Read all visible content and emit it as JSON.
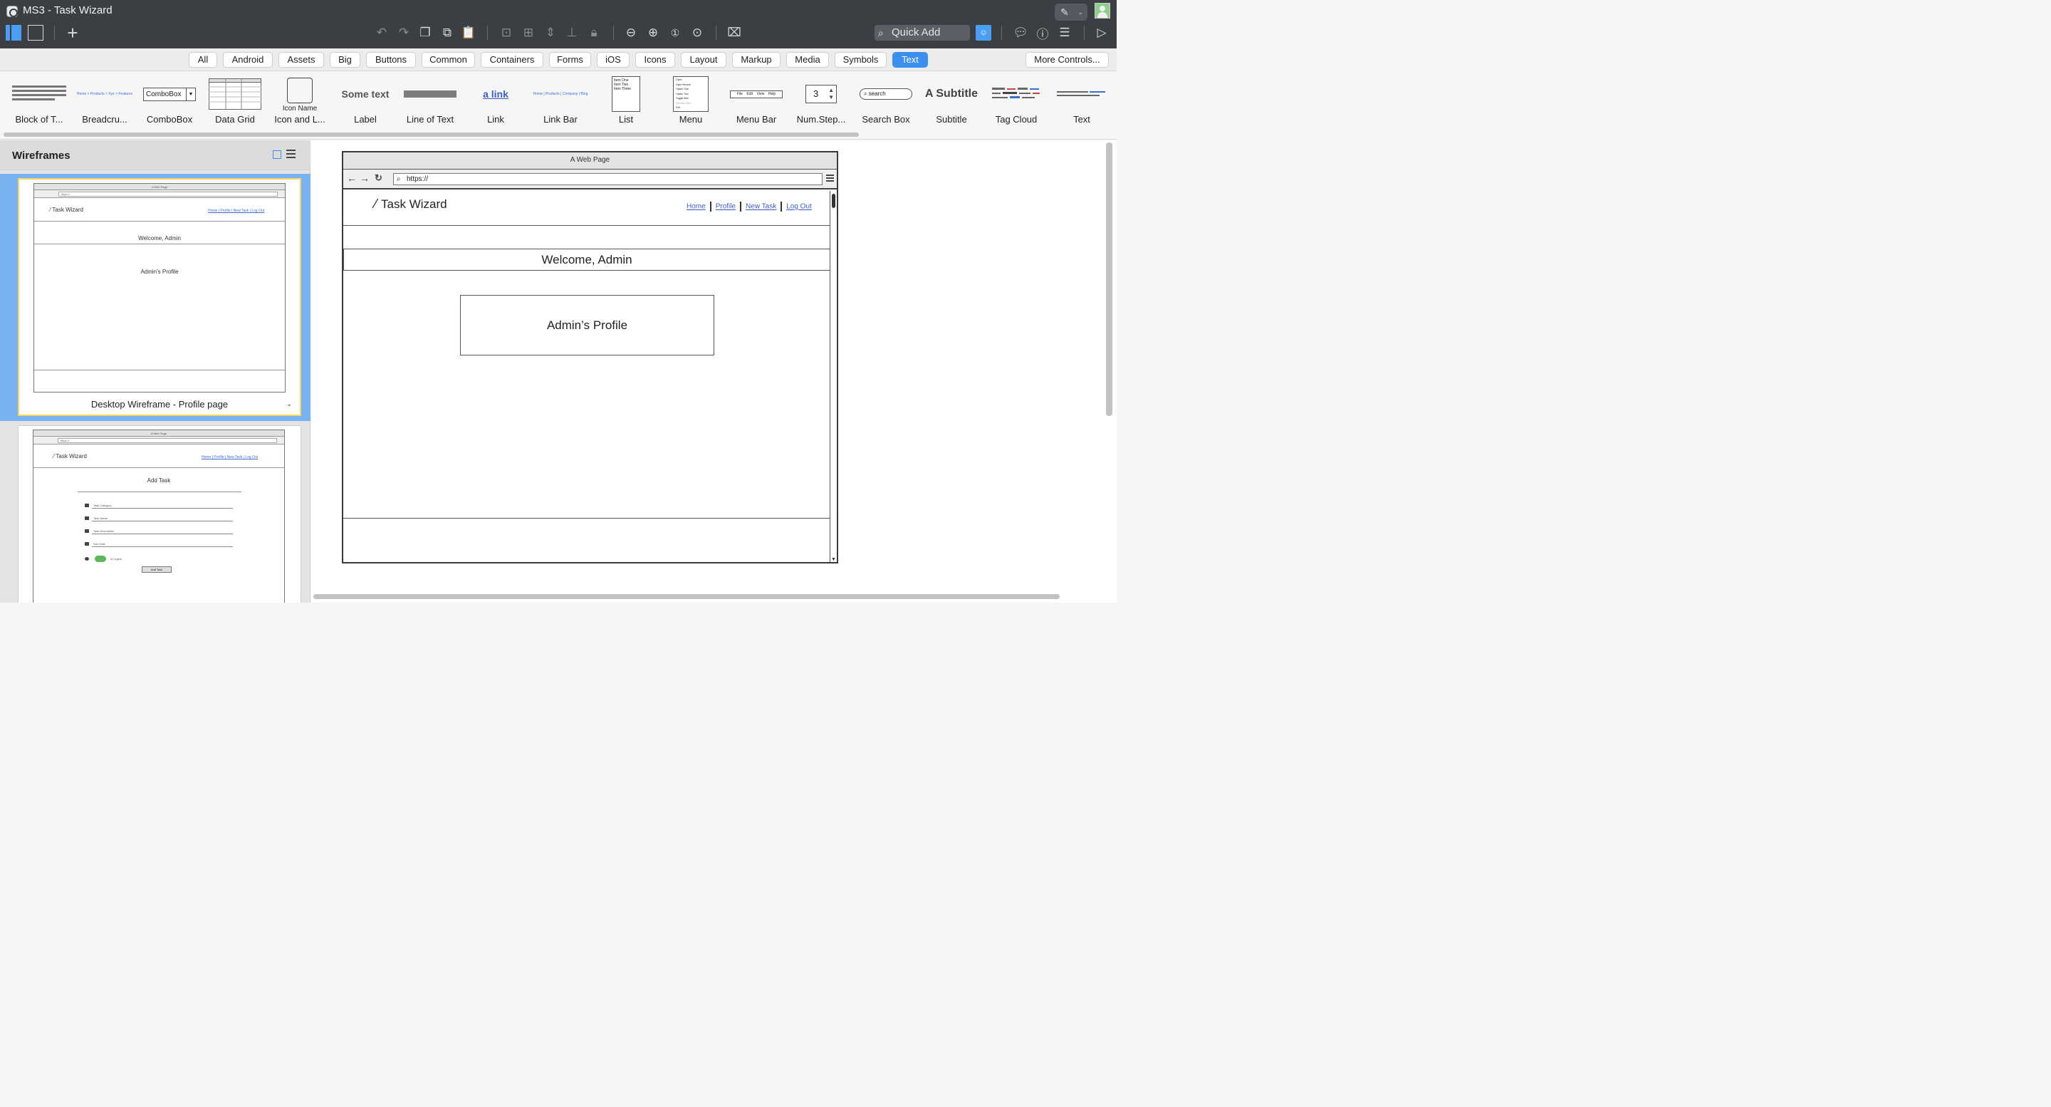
{
  "window": {
    "title": "MS3 - Task Wizard"
  },
  "toolbar": {
    "quick_add_placeholder": "Quick Add",
    "icons": [
      "single-view-icon",
      "grid-view-icon",
      "add-icon",
      "undo-icon",
      "redo-icon",
      "duplicate-icon",
      "copy-icon",
      "paste-icon",
      "group-icon",
      "ungroup-icon",
      "align-icon",
      "distribute-icon",
      "lock-icon",
      "zoom-out-icon",
      "zoom-in-icon",
      "actual-size-icon",
      "zoom-fit-icon",
      "delete-icon",
      "comments-icon",
      "info-icon",
      "properties-icon",
      "present-icon",
      "edit-icon",
      "user-icon"
    ]
  },
  "filters": {
    "items": [
      "All",
      "Android",
      "Assets",
      "Big",
      "Buttons",
      "Common",
      "Containers",
      "Forms",
      "iOS",
      "Icons",
      "Layout",
      "Markup",
      "Media",
      "Symbols",
      "Text"
    ],
    "active": "Text",
    "more": "More Controls..."
  },
  "components": {
    "labels": [
      "Block of T...",
      "Breadcru...",
      "ComboBox",
      "Data Grid",
      "Icon and L...",
      "Label",
      "Line of Text",
      "Link",
      "Link Bar",
      "List",
      "Menu",
      "Menu Bar",
      "Num.Step...",
      "Search Box",
      "Subtitle",
      "Tag Cloud",
      "Text"
    ],
    "previews": {
      "breadcrumb": "Home > Products > Xyz > Features",
      "combobox": "ComboBox",
      "icon_name": "Icon Name",
      "label": "Some text",
      "link": "a link",
      "linkbar": "Home | Products | Company | Blog",
      "list": [
        "Item One",
        "Item Two",
        "Item Three"
      ],
      "menu": [
        "Open",
        "Open Recent",
        "Option One",
        "Option Two",
        "Toggle Item",
        "Disabled Item",
        "Exit"
      ],
      "menubar": [
        "File",
        "Edit",
        "View",
        "Help"
      ],
      "stepper": "3",
      "search": "search",
      "subtitle": "A Subtitle"
    }
  },
  "panel": {
    "title": "Wireframes",
    "pages": [
      {
        "caption": "Desktop Wireframe - Profile page",
        "welcome": "Welcome, Admin",
        "profile": "Admin's Profile"
      },
      {
        "caption": "",
        "heading": "Add Task",
        "fields": [
          "Task Category",
          "Task Name",
          "Task Description",
          "Due Date",
          "Is Urgent"
        ],
        "button": "Add Task"
      }
    ]
  },
  "mock": {
    "browser_title": "A Web Page",
    "url": "https://",
    "mini_url": "https://",
    "logo": "Task Wizard",
    "nav": [
      "Home",
      "Profile",
      "New Task",
      "Log Out"
    ],
    "welcome": "Welcome, Admin",
    "profile": "Admin’s Profile"
  }
}
